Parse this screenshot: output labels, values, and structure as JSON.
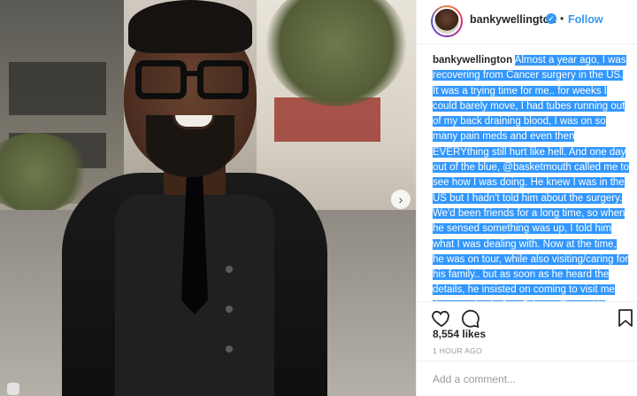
{
  "post": {
    "username": "bankywellington",
    "separator": "•",
    "follow_label": "Follow",
    "caption_username": "bankywellington",
    "caption_text": "Almost a year ago, I was recovering from Cancer surgery in the US. It was a trying time for me.. for weeks I could barely move, I had tubes running out of my back draining blood, I was on so many pain meds and even then EVERYthing still hurt like hell. And one day out of the blue, @basketmouth called me to see how I was doing. He knew I was in the US but I hadn't told him about the surgery. We'd been friends for a long time, so when he sensed something was up, I told him what I was dealing with. Now at the time, he was on tour, while also visiting/caring for his family.. but as soon as he heard the details, he insisted on coming to visit me the next day before flying to Texas. He asked if I needed anything and I said no, but he kept insisting that there must be some groceries or. Much later, when that was finished, we",
    "likes": "8,554 likes",
    "timestamp": "1 HOUR AGO",
    "comment_placeholder": "Add a comment...",
    "next_arrow": "›",
    "verified_glyph": "✓"
  },
  "icons": {
    "like": "heart-icon",
    "comment": "comment-icon",
    "save": "bookmark-icon",
    "next": "chevron-right-icon",
    "verified": "verified-badge-icon"
  },
  "colors": {
    "accent": "#3897f0",
    "selection": "#3297fd",
    "text": "#262626",
    "muted": "#999999"
  }
}
